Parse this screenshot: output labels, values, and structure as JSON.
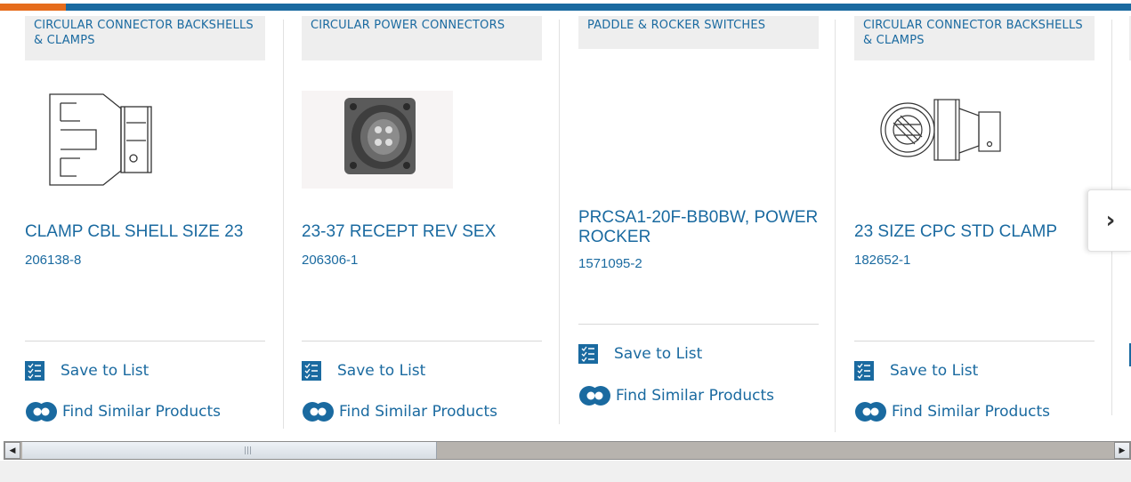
{
  "products": [
    {
      "category": "CIRCULAR CONNECTOR BACKSHELLS & CLAMPS",
      "title": "CLAMP CBL SHELL SIZE 23",
      "part_number": "206138-8",
      "save_label": "Save to List",
      "find_label": "Find Similar Products"
    },
    {
      "category": "CIRCULAR POWER CONNECTORS",
      "title": "23-37 RECEPT REV SEX",
      "part_number": "206306-1",
      "save_label": "Save to List",
      "find_label": "Find Similar Products"
    },
    {
      "category": "PADDLE & ROCKER SWITCHES",
      "title": "PRCSA1-20F-BB0BW, POWER ROCKER",
      "part_number": "1571095-2",
      "save_label": "Save to List",
      "find_label": "Find Similar Products"
    },
    {
      "category": "CIRCULAR CONNECTOR BACKSHELLS & CLAMPS",
      "title": "23 SIZE CPC STD CLAMP",
      "part_number": "182652-1",
      "save_label": "Save to List",
      "find_label": "Find Similar Products"
    }
  ],
  "carousel": {
    "next_icon": "chevron-right-icon",
    "next_glyph": "›"
  },
  "scrollbar": {
    "left_arrow": "◀",
    "right_arrow": "▶",
    "position_fraction": 0.37
  },
  "colors": {
    "accent": "#e66c1c",
    "brand": "#1a6aa0",
    "category_bg": "#eeeeee"
  }
}
